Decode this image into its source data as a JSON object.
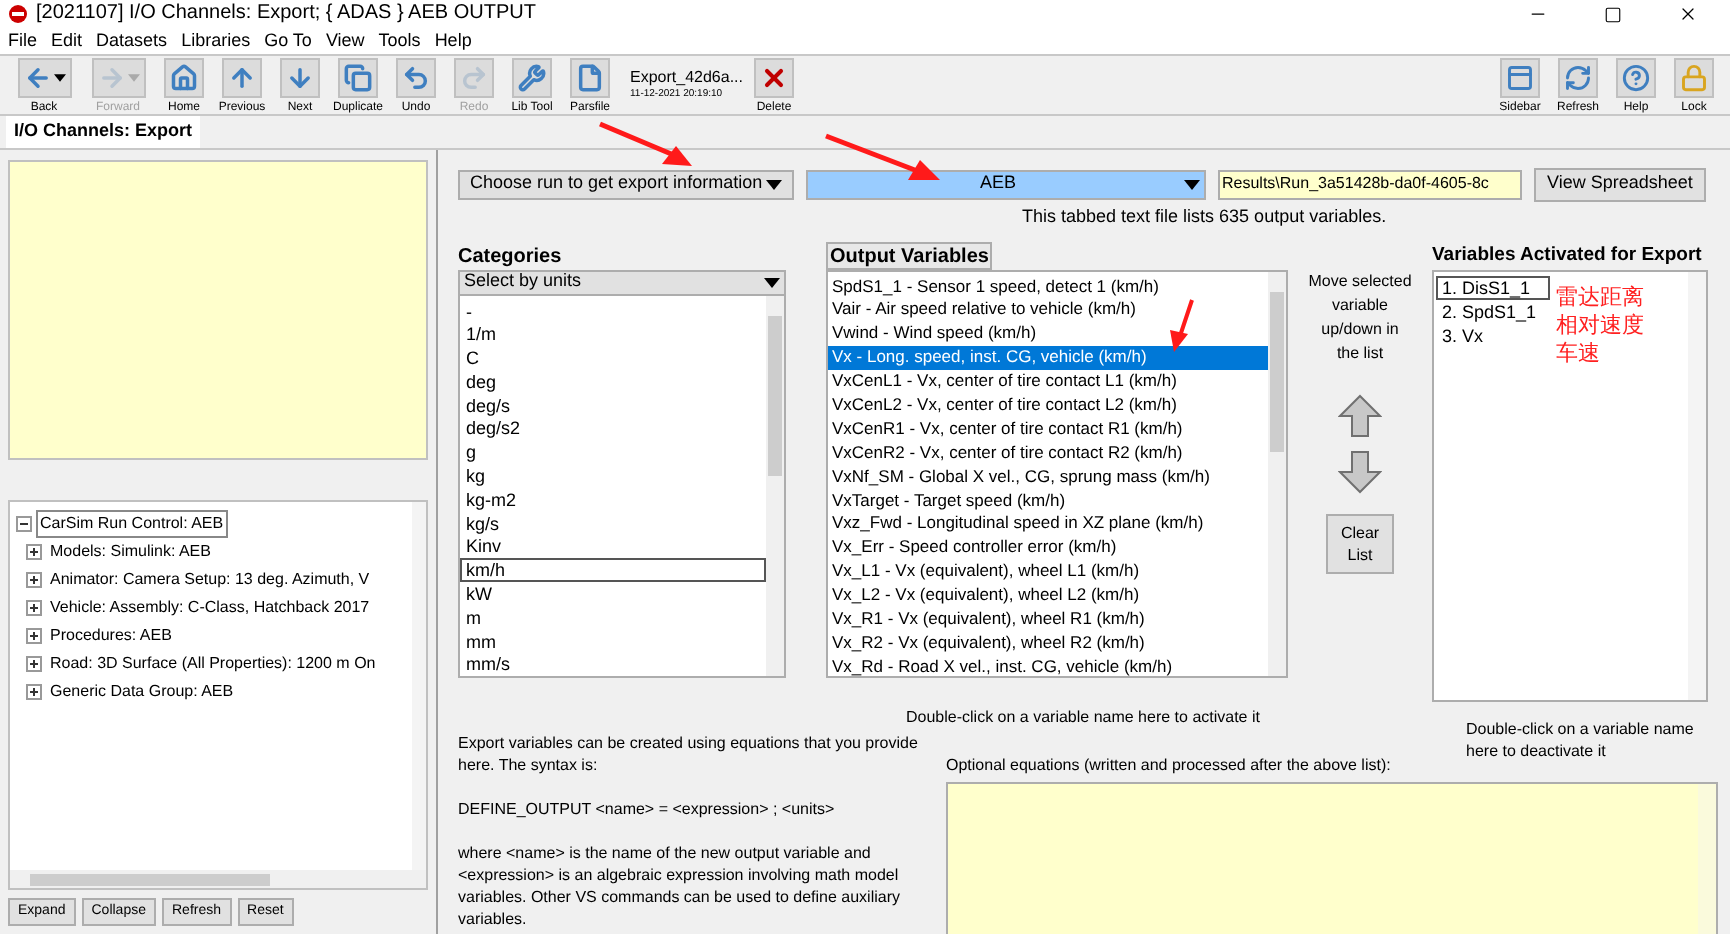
{
  "window": {
    "title": "[2021107] I/O Channels: Export; { ADAS } AEB OUTPUT"
  },
  "menu": [
    "File",
    "Edit",
    "Datasets",
    "Libraries",
    "Go To",
    "View",
    "Tools",
    "Help"
  ],
  "toolbar": [
    {
      "label": "Back",
      "disabled": false,
      "dropdown": true
    },
    {
      "label": "Forward",
      "disabled": true,
      "dropdown": true
    },
    {
      "label": "Home",
      "disabled": false,
      "dropdown": false
    },
    {
      "label": "Previous",
      "disabled": false,
      "dropdown": false
    },
    {
      "label": "Next",
      "disabled": false,
      "dropdown": false
    },
    {
      "label": "Duplicate",
      "disabled": false,
      "dropdown": false
    },
    {
      "label": "Undo",
      "disabled": false,
      "dropdown": false
    },
    {
      "label": "Redo",
      "disabled": true,
      "dropdown": false
    },
    {
      "label": "Lib Tool",
      "disabled": false,
      "dropdown": false
    },
    {
      "label": "Parsfile",
      "disabled": false,
      "dropdown": false
    }
  ],
  "dataset": {
    "name": "Export_42d6a...",
    "date": "11-12-2021 20:19:10",
    "delete_label": "Delete"
  },
  "toolbar_right": [
    "Sidebar",
    "Refresh",
    "Help",
    "Lock"
  ],
  "tab": {
    "label": "I/O Channels: Export",
    "selected": true
  },
  "tree": {
    "label": "CarSim Run Control: AEB",
    "expanded": true,
    "selected": true,
    "children": [
      {
        "label": "Models: Simulink: AEB",
        "expanded": false,
        "selected": false
      },
      {
        "label": "Animator: Camera Setup: 13 deg. Azimuth, V",
        "expanded": false,
        "selected": false
      },
      {
        "label": "Vehicle: Assembly: C-Class, Hatchback 2017",
        "expanded": false,
        "selected": false
      },
      {
        "label": "Procedures: AEB",
        "expanded": false,
        "selected": false
      },
      {
        "label": "Road: 3D Surface (All Properties): 1200 m On",
        "expanded": false,
        "selected": false
      },
      {
        "label": "Generic Data Group: AEB",
        "expanded": false,
        "selected": false
      }
    ]
  },
  "tree_buttons": [
    "Expand",
    "Collapse",
    "Refresh",
    "Reset"
  ],
  "run_dropdown": {
    "value": "Choose run to get export information"
  },
  "run_select": {
    "value": "AEB"
  },
  "results_path": {
    "value": "Results\\Run_3a51428b-da0f-4605-8c"
  },
  "view_spreadsheet": "View Spreadsheet",
  "file_note": "This tabbed text file lists 635 output variables.",
  "categories": {
    "title": "Categories",
    "select": "Select by units",
    "items": [
      {
        "label": "-",
        "selected": false
      },
      {
        "label": "1/m",
        "selected": false
      },
      {
        "label": "C",
        "selected": false
      },
      {
        "label": "deg",
        "selected": false
      },
      {
        "label": "deg/s",
        "selected": false
      },
      {
        "label": "deg/s2",
        "selected": false
      },
      {
        "label": "g",
        "selected": false
      },
      {
        "label": "kg",
        "selected": false
      },
      {
        "label": "kg-m2",
        "selected": false
      },
      {
        "label": "kg/s",
        "selected": false
      },
      {
        "label": "Kinv",
        "selected": false
      },
      {
        "label": "km/h",
        "selected": true
      },
      {
        "label": "kW",
        "selected": false
      },
      {
        "label": "m",
        "selected": false
      },
      {
        "label": "mm",
        "selected": false
      },
      {
        "label": "mm/s",
        "selected": false
      }
    ]
  },
  "output_variables": {
    "title": "Output Variables",
    "items": [
      {
        "label": "SpdS1_1 - Sensor 1 speed, detect 1 (km/h)",
        "selected": false
      },
      {
        "label": "Vair - Air speed relative to vehicle (km/h)",
        "selected": false
      },
      {
        "label": "Vwind - Wind speed (km/h)",
        "selected": false
      },
      {
        "label": "Vx - Long. speed, inst. CG, vehicle (km/h)",
        "selected": true
      },
      {
        "label": "VxCenL1 - Vx, center of tire contact L1 (km/h)",
        "selected": false
      },
      {
        "label": "VxCenL2 - Vx, center of tire contact L2 (km/h)",
        "selected": false
      },
      {
        "label": "VxCenR1 - Vx, center of tire contact R1 (km/h)",
        "selected": false
      },
      {
        "label": "VxCenR2 - Vx, center of tire contact R2 (km/h)",
        "selected": false
      },
      {
        "label": "VxNf_SM - Global X vel., CG, sprung mass (km/h)",
        "selected": false
      },
      {
        "label": "VxTarget - Target speed (km/h)",
        "selected": false
      },
      {
        "label": "Vxz_Fwd - Longitudinal speed in XZ plane (km/h)",
        "selected": false
      },
      {
        "label": "Vx_Err - Speed controller error (km/h)",
        "selected": false
      },
      {
        "label": "Vx_L1 - Vx (equivalent), wheel L1 (km/h)",
        "selected": false
      },
      {
        "label": "Vx_L2 - Vx (equivalent), wheel L2 (km/h)",
        "selected": false
      },
      {
        "label": "Vx_R1 - Vx (equivalent), wheel R1 (km/h)",
        "selected": false
      },
      {
        "label": "Vx_R2 - Vx (equivalent), wheel R2 (km/h)",
        "selected": false
      },
      {
        "label": "Vx_Rd - Road X vel., inst. CG, vehicle (km/h)",
        "selected": false
      }
    ],
    "hint": "Double-click on a variable name here to activate it"
  },
  "move_note": "Move selected variable up/down in the list",
  "clear_list": "Clear List",
  "activated": {
    "title": "Variables Activated for Export",
    "items": [
      {
        "label": "1. DisS1_1",
        "selected": true
      },
      {
        "label": "2. SpdS1_1",
        "selected": false
      },
      {
        "label": "3. Vx",
        "selected": false
      }
    ],
    "annotations": [
      "雷达距离",
      "相对速度",
      "车速"
    ],
    "hint": "Double-click on a variable name here to deactivate it"
  },
  "help_text": [
    "Export variables can be created using equations that you provide here. The syntax is:",
    "DEFINE_OUTPUT <name> = <expression> ; <units>",
    "where <name> is the name of the new output variable and <expression> is an algebraic expression involving math model variables. Other VS commands can be used to define auxiliary variables."
  ],
  "equations": {
    "label": "Optional equations (written and processed after the above list):"
  }
}
